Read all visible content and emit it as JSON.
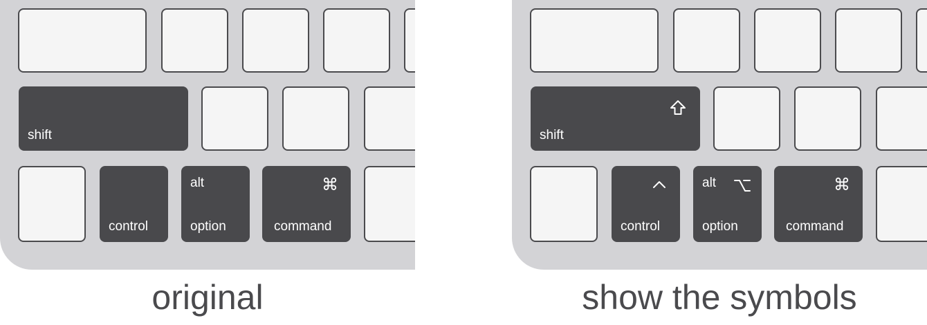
{
  "left": {
    "caption": "original",
    "keys": {
      "shift": "shift",
      "control": "control",
      "option_top": "alt",
      "option": "option",
      "command": "command",
      "command_symbol": "⌘"
    }
  },
  "right": {
    "caption": "show the symbols",
    "keys": {
      "shift": "shift",
      "shift_symbol": "⇧",
      "control": "control",
      "control_symbol": "^",
      "option_top": "alt",
      "option_symbol": "⌥",
      "option": "option",
      "command": "command",
      "command_symbol": "⌘"
    }
  },
  "icons": {
    "shift": "shift-arrow-icon",
    "control": "caret-icon",
    "option": "option-key-icon",
    "command": "command-key-icon"
  },
  "colors": {
    "keyboard_body": "#d3d3d6",
    "light_key": "#f5f5f5",
    "dark_key": "#49494c",
    "key_border": "#4a4a4d",
    "caption_text": "#4a4a4d"
  }
}
